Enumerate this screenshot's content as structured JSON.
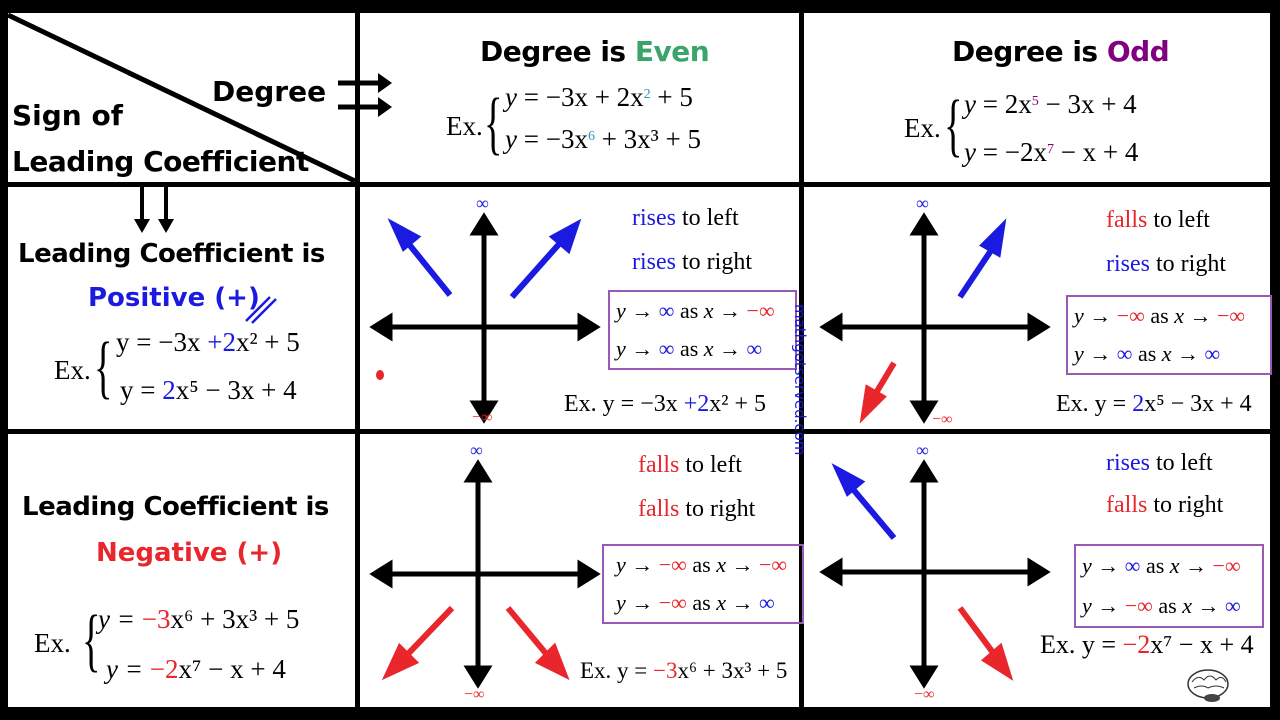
{
  "corner": {
    "top_label": "Degree",
    "bottom_label_line1": "Sign of",
    "bottom_label_line2": "Leading Coefficient"
  },
  "columns": [
    {
      "title_prefix": "Degree is ",
      "title_word": "Even",
      "title_color": "#3aa56a",
      "ex_label": "Ex.",
      "examples": [
        {
          "lhs": "y",
          "rhs": "= −3x + 2x",
          "exp": "2",
          "tail": " + 5"
        },
        {
          "lhs": "y",
          "rhs": "= −3x",
          "exp": "6",
          "tail": " + 3x³ + 5"
        }
      ]
    },
    {
      "title_prefix": "Degree is ",
      "title_word": "Odd",
      "title_color": "#800080",
      "ex_label": "Ex.",
      "examples": [
        {
          "lhs": "y",
          "rhs": "= 2x",
          "exp": "5",
          "tail": " − 3x + 4"
        },
        {
          "lhs": "y",
          "rhs": "= −2x",
          "exp": "7",
          "tail": " − x + 4"
        }
      ]
    }
  ],
  "rows": [
    {
      "label_line1": "Leading Coefficient is",
      "label_line2": "Positive (+)",
      "label_color": "#1a1ae0",
      "ex_label": "Ex.",
      "examples": [
        {
          "text_a": "y = −3x ",
          "text_b": "+2",
          "text_c": "x² + 5"
        },
        {
          "text_a": "y = ",
          "text_b": "2",
          "text_c": "x⁵ − 3x + 4"
        }
      ]
    },
    {
      "label_line1": "Leading Coefficient is",
      "label_line2": "Negative (+)",
      "label_color": "#e8262b",
      "ex_label": "Ex.",
      "examples": [
        {
          "text_a": "y = ",
          "text_b": "−3",
          "text_c": "x⁶ + 3x³ + 5"
        },
        {
          "text_a": "y = ",
          "text_b": "−2",
          "text_c": "x⁷ − x + 4"
        }
      ]
    }
  ],
  "cells": {
    "pos_even": {
      "left_word": "rises",
      "left_dir": "to left",
      "right_word": "rises",
      "right_dir": "to right",
      "lim1_y": "∞",
      "lim1_x": "−∞",
      "lim2_y": "∞",
      "lim2_x": "∞",
      "example": {
        "a": "Ex. y = −3x ",
        "b": "+2",
        "c": "x² + 5"
      },
      "top_inf": "∞",
      "bottom_inf": "−∞"
    },
    "pos_odd": {
      "left_word": "falls",
      "left_dir": "to left",
      "right_word": "rises",
      "right_dir": "to right",
      "lim1_y": "−∞",
      "lim1_x": "−∞",
      "lim2_y": "∞",
      "lim2_x": "∞",
      "example": {
        "a": "Ex. y = ",
        "b": "2",
        "c": "x⁵ − 3x + 4"
      },
      "top_inf": "∞",
      "bottom_inf": "−∞"
    },
    "neg_even": {
      "left_word": "falls",
      "left_dir": "to left",
      "right_word": "falls",
      "right_dir": "to right",
      "lim1_y": "−∞",
      "lim1_x": "−∞",
      "lim2_y": "−∞",
      "lim2_x": "∞",
      "example": {
        "a": "Ex.  y = ",
        "b": "−3",
        "c": "x⁶ + 3x³ + 5"
      },
      "top_inf": "∞",
      "bottom_inf": "−∞"
    },
    "neg_odd": {
      "left_word": "rises",
      "left_dir": "to left",
      "right_word": "falls",
      "right_dir": "to right",
      "lim1_y": "∞",
      "lim1_x": "−∞",
      "lim2_y": "−∞",
      "lim2_x": "∞",
      "example": {
        "a": "Ex. y = ",
        "b": "−2",
        "c": "x⁷ − x + 4"
      },
      "top_inf": "∞",
      "bottom_inf": "−∞"
    }
  },
  "limit_words": {
    "y": "y",
    "arrow": "→",
    "as": "as",
    "x": "x"
  },
  "watermark": "mathgotserved.com",
  "colors": {
    "rise": "#1a1ae0",
    "fall": "#e8262b",
    "even": "#3aa56a",
    "odd": "#800080",
    "limit_box": "#9b59b6"
  }
}
